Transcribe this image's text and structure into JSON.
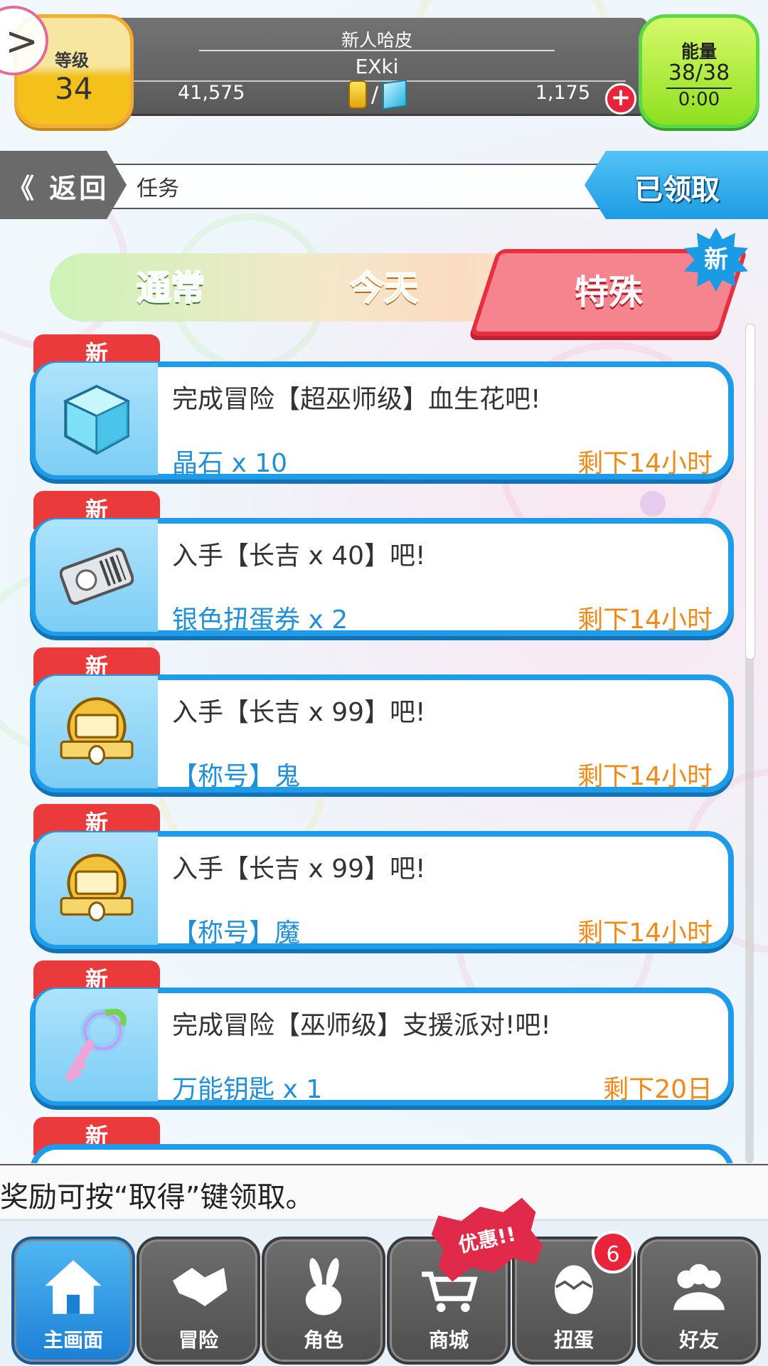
{
  "header": {
    "player_title": "新人哈皮",
    "player_id": "EXki",
    "level_label": "等级",
    "level_value": "34",
    "gold": "41,575",
    "gems": "1,175",
    "currency_separator": "/",
    "add_currency": "+",
    "energy_label": "能量",
    "energy_value": "38/38",
    "energy_timer": "0:00",
    "menu_arrow": ">"
  },
  "nav": {
    "back_label": "《 返回",
    "page_title": "任务",
    "claimed_label": "已领取"
  },
  "tabs": {
    "normal": "通常",
    "today": "今天",
    "special": "特殊",
    "new_burst": "新"
  },
  "missions": [
    {
      "tag": "新",
      "title": "完成冒险【超巫师级】血生花吧!",
      "reward": "晶石 x 10",
      "remaining": "剩下14小时",
      "icon": "crystal-gem-icon"
    },
    {
      "tag": "新",
      "title": "入手【长吉 x 40】吧!",
      "reward": "银色扭蛋券 x 2",
      "remaining": "剩下14小时",
      "icon": "silver-gacha-ticket-icon"
    },
    {
      "tag": "新",
      "title": "入手【长吉 x 99】吧!",
      "reward": "【称号】鬼",
      "remaining": "剩下14小时",
      "icon": "title-badge-icon"
    },
    {
      "tag": "新",
      "title": "入手【长吉 x 99】吧!",
      "reward": "【称号】魔",
      "remaining": "剩下14小时",
      "icon": "title-badge-icon"
    },
    {
      "tag": "新",
      "title": "完成冒险【巫师级】支援派对!吧!",
      "reward": "万能钥匙 x 1",
      "remaining": "剩下20日",
      "icon": "master-key-icon"
    },
    {
      "tag": "新",
      "title": "",
      "reward": "",
      "remaining": "",
      "icon": ""
    }
  ],
  "hint": "奖励可按“取得”键领取。",
  "bottom_nav": {
    "home": "主画面",
    "adventure": "冒险",
    "character": "角色",
    "shop": "商城",
    "gacha": "扭蛋",
    "friends": "好友",
    "promo": "优惠!!",
    "gacha_badge": "6"
  },
  "colors": {
    "accent_blue": "#1e9be9",
    "new_red": "#ea3a3c",
    "remaining_orange": "#ef8a18",
    "reward_blue": "#2290d6",
    "energy_green": "#8fe020",
    "level_gold": "#f4c01c"
  }
}
